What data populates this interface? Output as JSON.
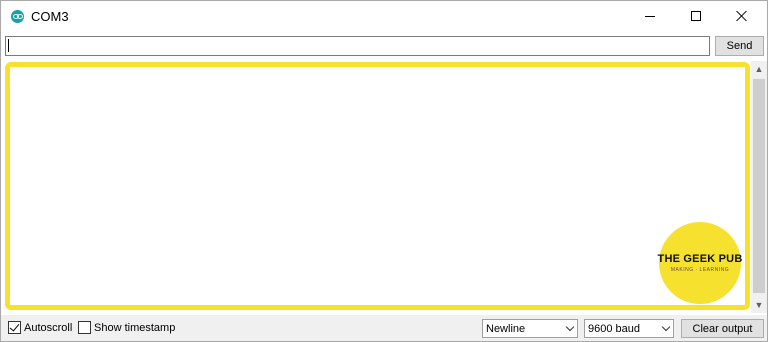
{
  "window": {
    "title": "COM3",
    "app_icon": "arduino-icon",
    "controls": [
      "minimize-icon",
      "maximize-icon",
      "close-icon"
    ]
  },
  "input": {
    "value": "",
    "send_label": "Send"
  },
  "output": {
    "text": "",
    "frame_color": "#f7e12f"
  },
  "watermark": {
    "main": "THE GEEK PUB",
    "sub": "MAKING · LEARNING",
    "color": "#f7e12f"
  },
  "footer": {
    "autoscroll": {
      "label": "Autoscroll",
      "checked": true
    },
    "timestamp": {
      "label": "Show timestamp",
      "checked": false
    },
    "line_ending": "Newline",
    "baud": "9600 baud",
    "clear_label": "Clear output"
  }
}
